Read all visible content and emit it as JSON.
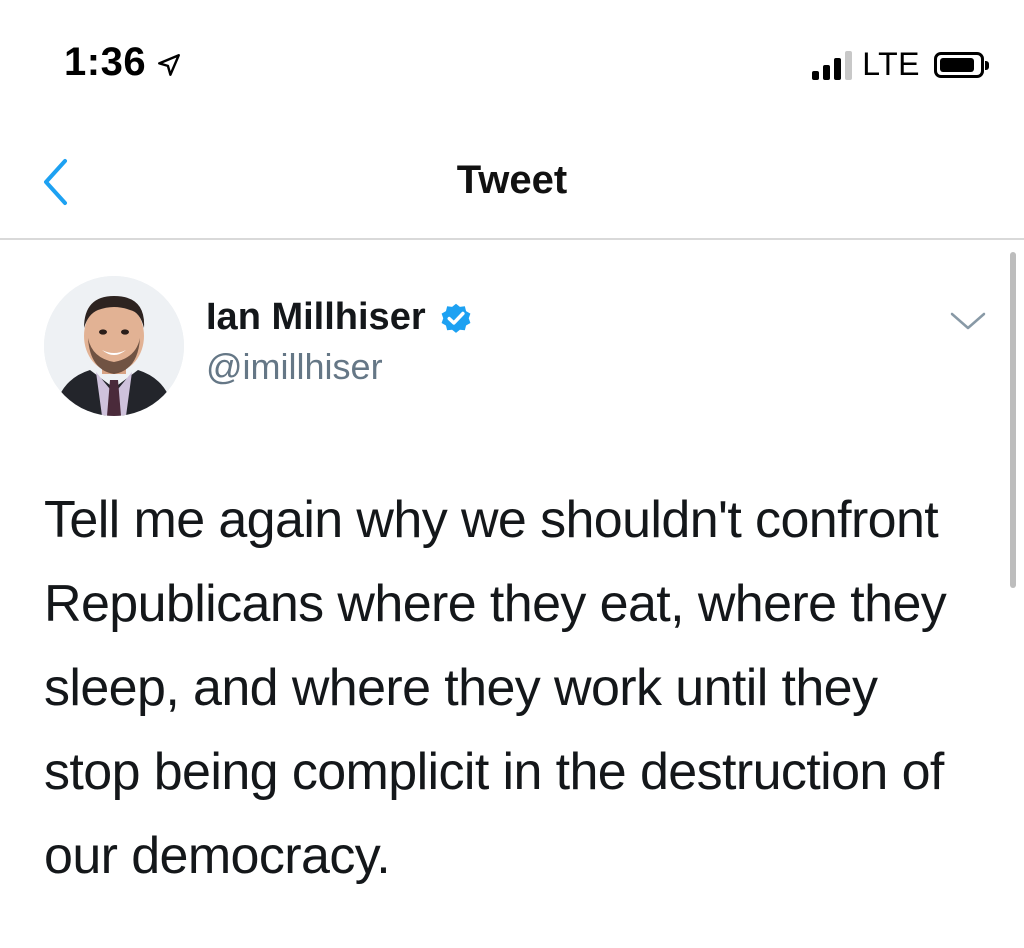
{
  "status_bar": {
    "time": "1:36",
    "network": "LTE",
    "icons": [
      "location-arrow-icon",
      "signal-bars-icon",
      "battery-icon"
    ]
  },
  "nav": {
    "title": "Tweet",
    "back_icon": "chevron-left-icon"
  },
  "tweet": {
    "author_name": "Ian Millhiser",
    "author_handle": "@imillhiser",
    "verified": true,
    "text": "Tell me again why we shouldn't confront Republicans where they eat, where they sleep, and where they work until they stop being complicit in the destruction of our democracy.",
    "more_icon": "chevron-down-icon"
  },
  "colors": {
    "accent": "#1da1f2",
    "handle": "#657786",
    "text": "#14171a",
    "divider": "#d9d9d9"
  }
}
